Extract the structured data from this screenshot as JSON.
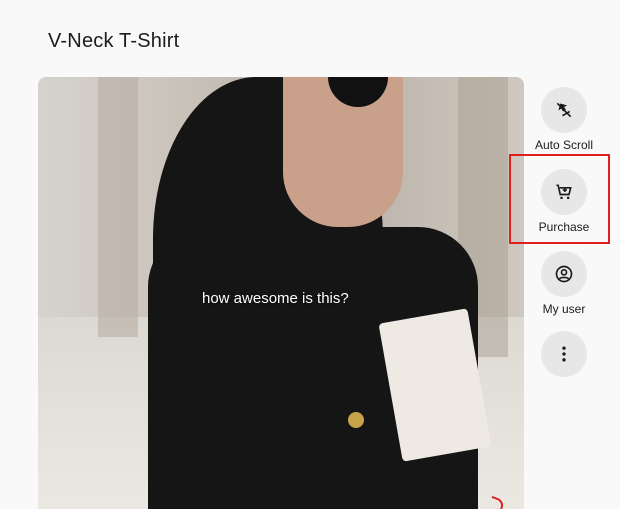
{
  "header": {
    "title": "V-Neck T-Shirt"
  },
  "video": {
    "caption": "how awesome is this?"
  },
  "actions": [
    {
      "label": "Auto Scroll",
      "icon": "auto-scroll-icon"
    },
    {
      "label": "Purchase",
      "icon": "cart-add-icon"
    },
    {
      "label": "My user",
      "icon": "user-icon"
    },
    {
      "label": "",
      "icon": "more-vertical-icon"
    }
  ],
  "colors": {
    "highlight": "#e02020",
    "action_bg": "#e7e7e7",
    "page_bg": "#f9f9f9"
  }
}
